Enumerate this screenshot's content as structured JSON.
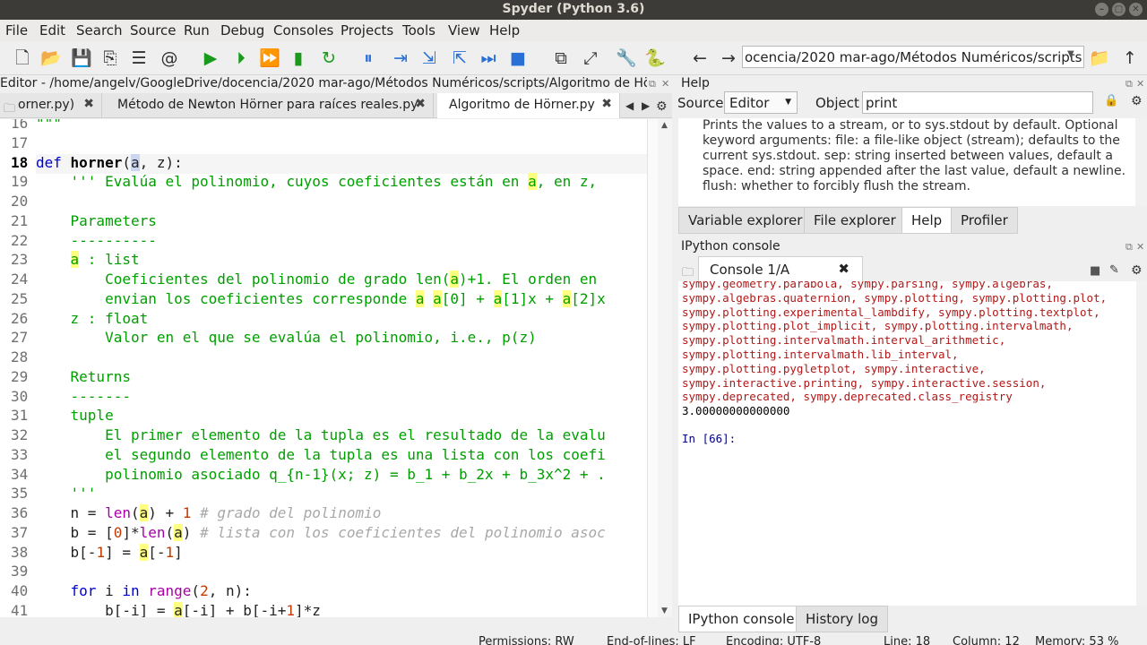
{
  "window": {
    "title": "Spyder (Python 3.6)",
    "controls": [
      "–",
      "▢",
      "✕"
    ]
  },
  "menu": [
    "File",
    "Edit",
    "Search",
    "Source",
    "Run",
    "Debug",
    "Consoles",
    "Projects",
    "Tools",
    "View",
    "Help"
  ],
  "toolbar": {
    "icons": [
      "new-file-icon",
      "open-folder-icon",
      "save-icon",
      "save-all-icon",
      "list-icon",
      "at-icon",
      "run-icon",
      "run-cell-icon",
      "run-cell-advance-icon",
      "run-selection-icon",
      "rerun-icon",
      "debug-icon",
      "step-icon",
      "step-into-icon",
      "step-return-icon",
      "continue-icon",
      "stop-icon",
      "maximize-pane-icon",
      "fullscreen-icon",
      "preferences-icon",
      "python-path-icon",
      "back-arrow-icon",
      "forward-arrow-icon",
      "browse-folder-icon",
      "up-arrow-icon"
    ],
    "glyphs": [
      "🗋",
      "📂",
      "💾",
      "⎘",
      "☰",
      "@",
      "▶",
      "⏵",
      "⏩",
      "▮",
      "↻",
      "⏸",
      "⇥",
      "⇲",
      "⇱",
      "⏭",
      "■",
      "⧉",
      "⤢",
      "🔧",
      "🐍",
      "←",
      "→",
      "📁",
      "↑"
    ],
    "path": "ocencia/2020 mar-ago/Métodos Numéricos/scripts"
  },
  "editor": {
    "title": "Editor - /home/angelv/GoogleDrive/docencia/2020 mar-ago/Métodos Numéricos/scripts/Algoritmo de Hö...",
    "tabs": [
      {
        "label": "orner.py)",
        "close": "✖"
      },
      {
        "label": "Método de Newton Hörner para raíces reales.py",
        "close": "✖"
      },
      {
        "label": "Algoritmo de Hörner.py",
        "close": "✖"
      }
    ],
    "lines": [
      {
        "n": "16",
        "html": "<span class='doc'>\"\"\"</span>"
      },
      {
        "n": "17",
        "html": ""
      },
      {
        "n": "18",
        "html": "<span class='kw'>def</span> <span class='fn'>horner</span>(<span class='sel'>a</span>, z):"
      },
      {
        "n": "19",
        "html": "    <span class='doc'>''' Evalúa el polinomio, cuyos coeficientes están en <span class='hl'>a</span>, en z,</span>"
      },
      {
        "n": "20",
        "html": ""
      },
      {
        "n": "21",
        "html": "    <span class='doc'>Parameters</span>"
      },
      {
        "n": "22",
        "html": "    <span class='doc'>----------</span>"
      },
      {
        "n": "23",
        "html": "    <span class='doc'><span class='hl'>a</span> : list</span>"
      },
      {
        "n": "24",
        "html": "    <span class='doc'>    Coeficientes del polinomio de grado len(<span class='hl'>a</span>)+1. El orden en</span>"
      },
      {
        "n": "25",
        "html": "    <span class='doc'>    envian los coeficientes corresponde <span class='hl'>a</span> <span class='hl'>a</span>[0] + <span class='hl'>a</span>[1]x + <span class='hl'>a</span>[2]x</span>"
      },
      {
        "n": "26",
        "html": "    <span class='doc'>z : float</span>"
      },
      {
        "n": "27",
        "html": "    <span class='doc'>    Valor en el que se evalúa el polinomio, i.e., p(z)</span>"
      },
      {
        "n": "28",
        "html": ""
      },
      {
        "n": "29",
        "html": "    <span class='doc'>Returns</span>"
      },
      {
        "n": "30",
        "html": "    <span class='doc'>-------</span>"
      },
      {
        "n": "31",
        "html": "    <span class='doc'>tuple</span>"
      },
      {
        "n": "32",
        "html": "    <span class='doc'>    El primer elemento de la tupla es el resultado de la evalu</span>"
      },
      {
        "n": "33",
        "html": "    <span class='doc'>    el segundo elemento de la tupla es una lista con los coefi</span>"
      },
      {
        "n": "34",
        "html": "    <span class='doc'>    polinomio asociado q_{n-1}(x; z) = b_1 + b_2x + b_3x^2 + .</span>"
      },
      {
        "n": "35",
        "html": "    <span class='doc'>'''</span>"
      },
      {
        "n": "36",
        "html": "    n = <span class='bi'>len</span>(<span class='hl'>a</span>) + <span class='num'>1</span> <span class='cm'># grado del polinomio</span>"
      },
      {
        "n": "37",
        "html": "    b = [<span class='num'>0</span>]*<span class='bi'>len</span>(<span class='hl'>a</span>) <span class='cm'># lista con los coeficientes del polinomio asoc</span>"
      },
      {
        "n": "38",
        "html": "    b[-<span class='num'>1</span>] = <span class='hl'>a</span>[-<span class='num'>1</span>]"
      },
      {
        "n": "39",
        "html": ""
      },
      {
        "n": "40",
        "html": "    <span class='kw'>for</span> i <span class='kw'>in</span> <span class='bi'>range</span>(<span class='num'>2</span>, n):"
      },
      {
        "n": "41",
        "html": "        b[-i] = <span class='hl'>a</span>[-i] + b[-i+<span class='num'>1</span>]*z"
      }
    ]
  },
  "help": {
    "title": "Help",
    "source_label": "Source",
    "source_value": "Editor",
    "object_label": "Object",
    "object_value": "print",
    "text": "Prints the values to a stream, or to sys.stdout by default. Optional keyword arguments: file: a file-like object (stream); defaults to the current sys.stdout. sep: string inserted between values, default a space. end: string appended after the last value, default a newline. flush: whether to forcibly flush the stream.",
    "tabs": [
      "Variable explorer",
      "File explorer",
      "Help",
      "Profiler"
    ]
  },
  "ipython": {
    "title": "IPython console",
    "tab": "Console 1/A",
    "lines": [
      "sympy.geometry.parabola, sympy.parsing, sympy.algebras,",
      "sympy.algebras.quaternion, sympy.plotting, sympy.plotting.plot,",
      "sympy.plotting.experimental_lambdify, sympy.plotting.textplot,",
      "sympy.plotting.plot_implicit, sympy.plotting.intervalmath,",
      "sympy.plotting.intervalmath.interval_arithmetic,",
      "sympy.plotting.intervalmath.lib_interval,",
      "sympy.plotting.pygletplot, sympy.interactive,",
      "sympy.interactive.printing, sympy.interactive.session,",
      "sympy.deprecated, sympy.deprecated.class_registry"
    ],
    "result": "3.00000000000000",
    "prompt": "In [66]:",
    "bottom_tabs": [
      "IPython console",
      "History log"
    ]
  },
  "status": [
    "Permissions: RW",
    "End-of-lines: LF",
    "Encoding: UTF-8",
    "Line: 18",
    "Column: 12",
    "Memory: 53 %"
  ]
}
